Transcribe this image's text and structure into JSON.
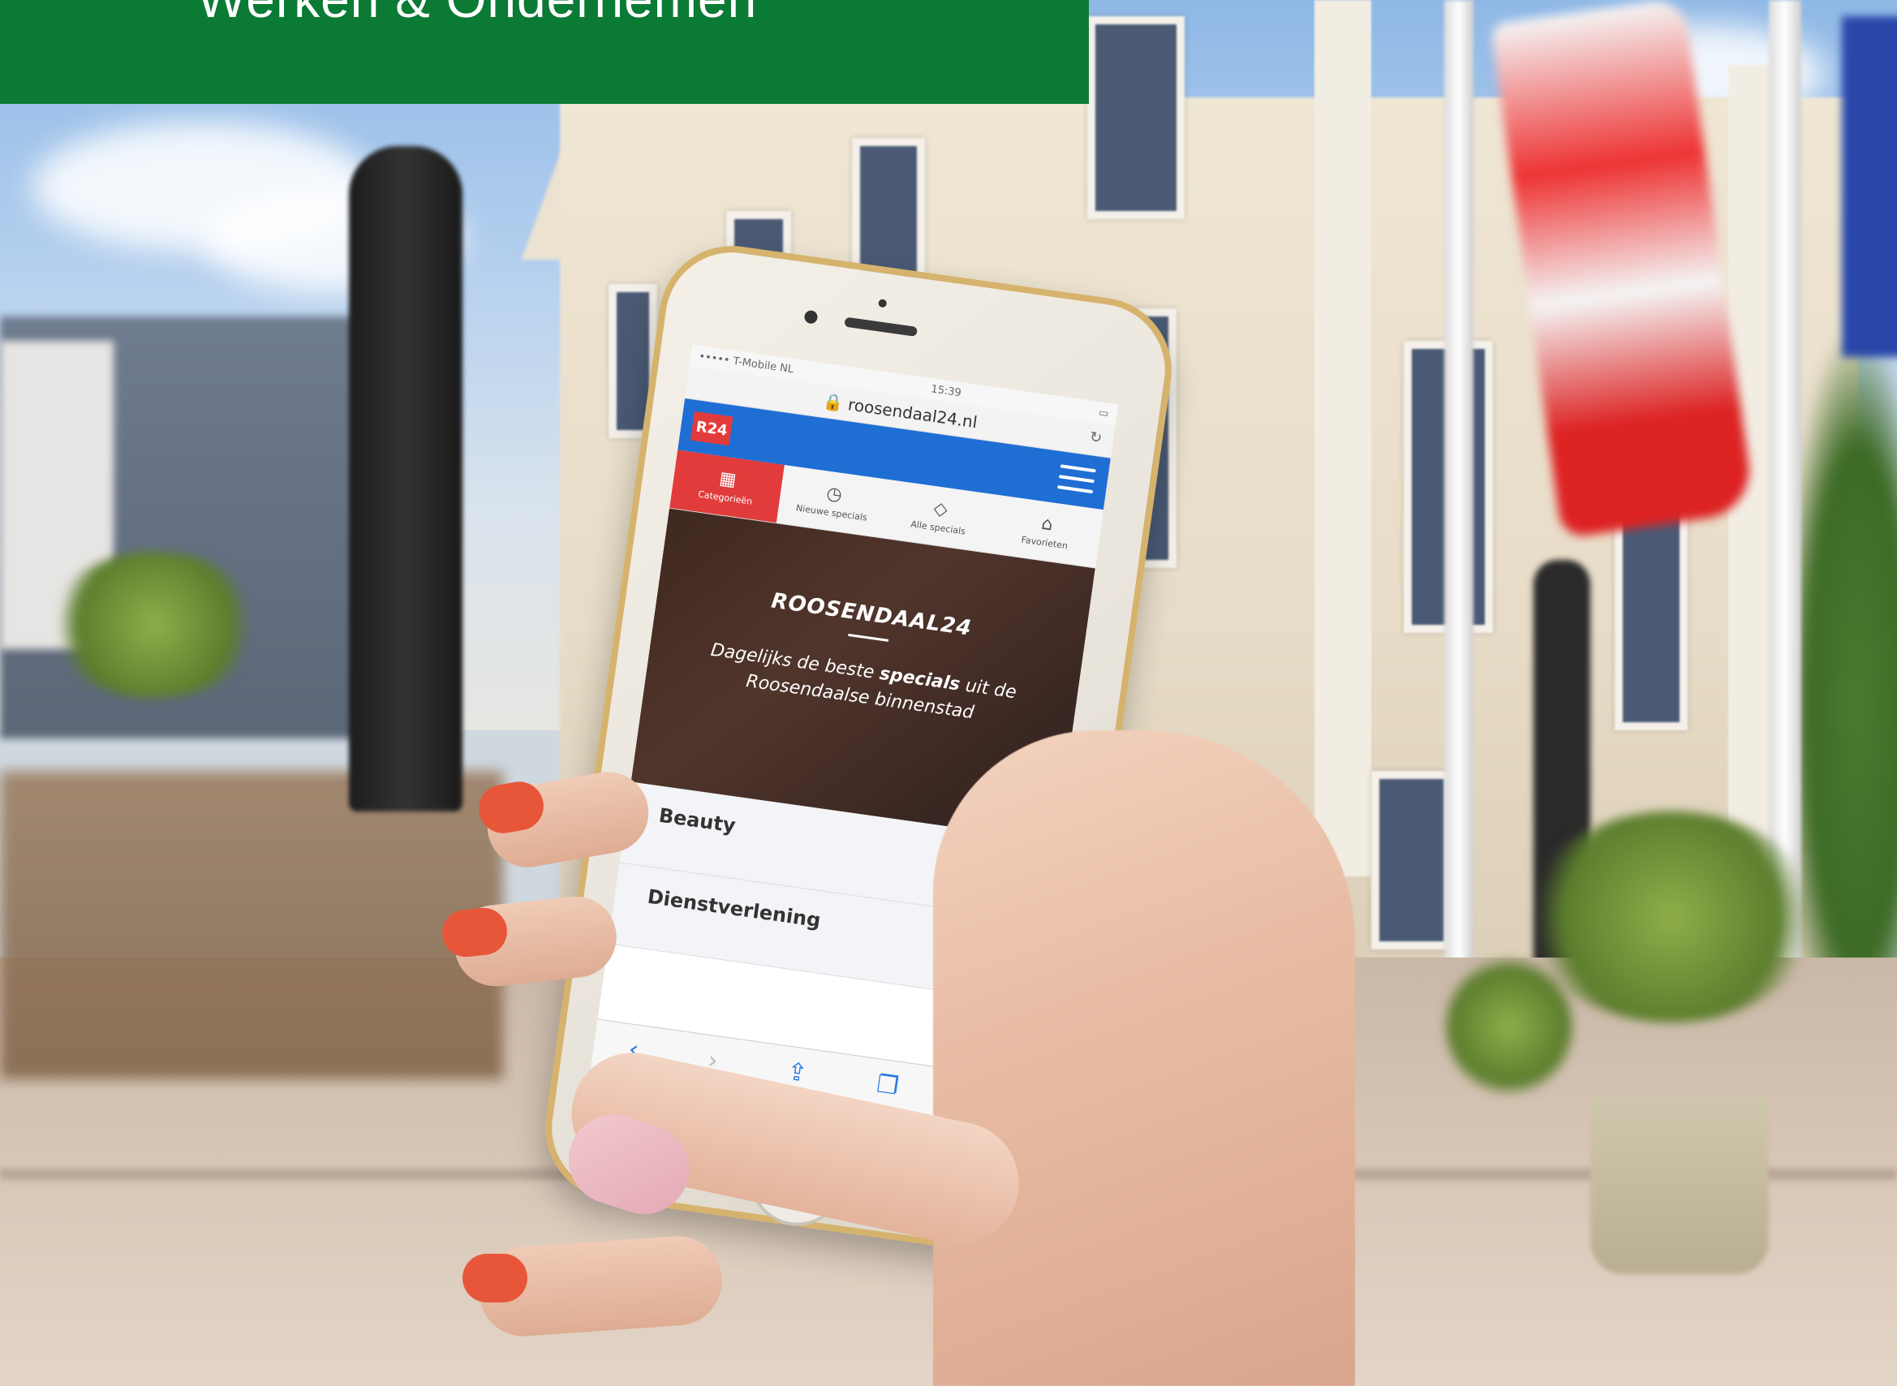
{
  "banner": {
    "title": "Werken & Ondernemen",
    "background_color": "#0b7a35"
  },
  "phone": {
    "status_left": "••••• T-Mobile NL",
    "status_time": "15:39",
    "url": "roosendaal24.nl",
    "logo": "R24",
    "tabs": [
      {
        "label": "Categorieën",
        "icon": "grid-icon"
      },
      {
        "label": "Nieuwe specials",
        "icon": "clock-icon"
      },
      {
        "label": "Alle specials",
        "icon": "tag-icon"
      },
      {
        "label": "Favorieten",
        "icon": "bag-icon"
      }
    ],
    "hero": {
      "title": "ROOSENDAAL24",
      "text_before": "Dagelijks de beste ",
      "text_bold": "specials",
      "text_after": " uit de Roosendaalse binnenstad"
    },
    "list": [
      {
        "label": "Beauty"
      },
      {
        "label": "Dienstverlening"
      }
    ],
    "accent_color": "#1f6ed4",
    "active_tab_color": "#e23b3b"
  }
}
